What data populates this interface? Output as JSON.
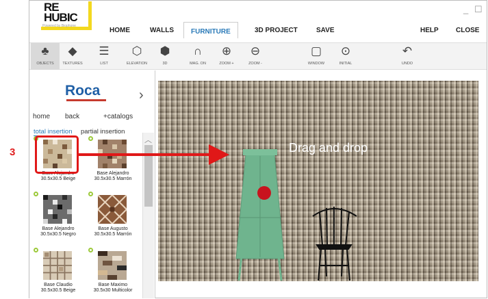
{
  "logo": {
    "line1": "RE",
    "line2": "HUBIC",
    "tagline": "Powered by Biophone"
  },
  "menu": {
    "home": "HOME",
    "walls": "WALLS",
    "furniture": "FURNITURE",
    "project3d": "3D PROJECT",
    "save": "SAVE",
    "help": "HELP",
    "close": "CLOSE"
  },
  "window_controls": {
    "minimize": "_",
    "maximize": "☐"
  },
  "toolbar": [
    {
      "label": "OBJECTS",
      "icon": "objects-icon",
      "glyph": "♣"
    },
    {
      "label": "TEXTURES",
      "icon": "cube-icon",
      "glyph": "◆"
    },
    {
      "label": "LIST",
      "icon": "list-icon",
      "glyph": "☰"
    },
    {
      "label": "ELEVATION",
      "icon": "elevation-icon",
      "glyph": "⬡"
    },
    {
      "label": "3D",
      "icon": "3d-icon",
      "glyph": "⬢"
    },
    {
      "label": "MAG. ON",
      "icon": "magnet-icon",
      "glyph": "∩"
    },
    {
      "label": "ZOOM +",
      "icon": "zoom-in-icon",
      "glyph": "⊕"
    },
    {
      "label": "ZOOM -",
      "icon": "zoom-out-icon",
      "glyph": "⊖"
    },
    {
      "label": "WINDOW",
      "icon": "zoom-window-icon",
      "glyph": "▢"
    },
    {
      "label": "INITIAL",
      "icon": "zoom-initial-icon",
      "glyph": "⊙"
    },
    {
      "label": "UNDO",
      "icon": "undo-icon",
      "glyph": "↶"
    }
  ],
  "catalog": {
    "brand": "Roca",
    "home": "home",
    "back": "back",
    "more": "+catalogs"
  },
  "insertion_tabs": {
    "total": "total insertion",
    "partial": "partial insertion"
  },
  "tiles": [
    {
      "line1": "Base Alejandro",
      "line2": "30.5x30.5 Beige",
      "pattern": "beige"
    },
    {
      "line1": "Base Alejandro",
      "line2": "30.5x30.5 Marrón",
      "pattern": "brown"
    },
    {
      "line1": "Base Alejandro",
      "line2": "30.5x30.5 Negro",
      "pattern": "black"
    },
    {
      "line1": "Base Augusto",
      "line2": "30.5x30.5 Marrón",
      "pattern": "augusto"
    },
    {
      "line1": "Base Claudio",
      "line2": "30.5x30.5 Beige",
      "pattern": "claudio"
    },
    {
      "line1": "Base Maximo",
      "line2": "30.5x30 Multicolor",
      "pattern": "maximo"
    }
  ],
  "annotation": {
    "step": "3",
    "instruction": "Drag and drop"
  },
  "colors": {
    "accent": "#2a7ab8",
    "highlight": "#e01818",
    "logo_bar": "#f3d81f",
    "cabinet": "#6fb48e"
  }
}
